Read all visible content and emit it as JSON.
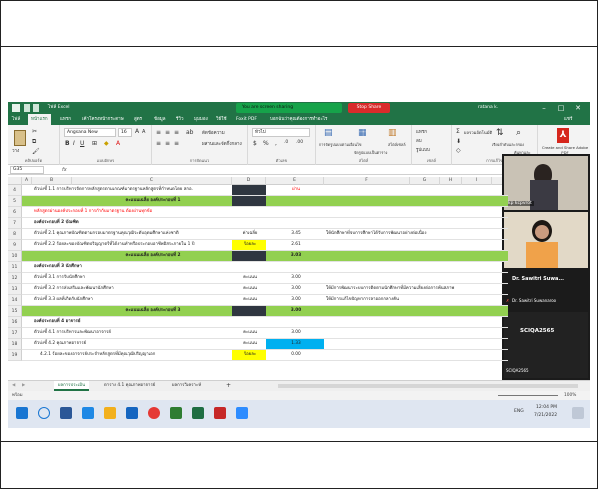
{
  "window": {
    "title_left": "ไฟล์ Excel",
    "share_status": "You are screen sharing",
    "stop_share": "Stop Share",
    "user": "ratana k.",
    "minimize": "–",
    "maximize": "□",
    "close": "✕"
  },
  "ribbon": {
    "tabs": [
      "ไฟล์",
      "หน้าแรก",
      "แทรก",
      "เค้าโครงหน้ากระดาษ",
      "สูตร",
      "ข้อมูล",
      "รีวิว",
      "มุมมอง",
      "วิธีใช้",
      "Foxit PDF",
      "บอกฉันว่าคุณต้องการทำอะไร"
    ],
    "active_tab_index": 1,
    "share_link": "แชร์",
    "font_name": "Angsana New",
    "font_size": "16",
    "number_format": "ทั่วไป",
    "groups": [
      "คลิปบอร์ด",
      "แบบอักษร",
      "การจัดแนว",
      "ตัวเลข",
      "สไตล์",
      "เซลล์",
      "การแก้ไข",
      "Adobe Acrobat"
    ],
    "buttons": {
      "paste": "วาง",
      "wrap": "ตัดข้อความ",
      "merge": "ผสานและจัดกึ่งกลาง",
      "conditional": "การจัดรูปแบบตามเงื่อนไข",
      "format_table": "จัดรูปแบบเป็นตาราง",
      "cell_styles": "สไตล์เซลล์",
      "insert": "แทรก",
      "delete": "ลบ",
      "format": "รูปแบบ",
      "autosum": "ผลรวมอัตโนมัติ",
      "sort": "เรียงลำดับและกรอง",
      "find": "ค้นหาและเลือก",
      "pdf": "Create and Share Adobe PDF"
    }
  },
  "formula_bar": {
    "name_box": "G35",
    "fx": "fx",
    "value": ""
  },
  "grid": {
    "columns": [
      "A",
      "B",
      "C",
      "D",
      "E",
      "F",
      "G",
      "H",
      "I"
    ],
    "rows": [
      {
        "num": "4",
        "b": "ตัวบ่งชี้ 1.1 การบริหารจัดการหลักสูตรตามเกณฑ์มาตรฐานหลักสูตรที่กำหนดโดย สกอ.",
        "c": "",
        "d": "",
        "e": "ผ่าน",
        "f": "",
        "style": "normal"
      },
      {
        "num": "5",
        "b": "",
        "c": "คะแนนเฉลี่ย องค์ประกอบที่ 1",
        "d": "",
        "e": "",
        "f": "",
        "style": "green"
      },
      {
        "num": "6",
        "b": "หลักสูตรผ่านองค์ประกอบที่ 1 การกำกับมาตรฐาน ต้องผ่านทุกข้อ",
        "c": "",
        "d": "",
        "e": "",
        "f": "",
        "style": "red"
      },
      {
        "num": "7",
        "b": "องค์ประกอบที่ 2 บัณฑิต",
        "c": "",
        "d": "",
        "e": "",
        "f": "",
        "style": "bold"
      },
      {
        "num": "8",
        "b": "ตัวบ่งชี้ 2.1 คุณภาพบัณฑิตตามกรอบมาตรฐานคุณวุฒิระดับอุดมศึกษาแห่งชาติ",
        "c": "",
        "d": "ค่าเฉลี่ย",
        "e": "3.45",
        "f": "ให้นักศึกษาที่จบการศึกษาได้รับการพัฒนาอย่างต่อเนื่อง",
        "style": "normal"
      },
      {
        "num": "9",
        "b": "ตัวบ่งชี้ 2.2 ร้อยละของบัณฑิตปริญญาตรีที่ได้งานทำหรือประกอบอาชีพอิสระภายใน 1 ปี",
        "c": "",
        "d": "ร้อยละ",
        "e": "2.61",
        "f": "",
        "style": "yellow-d"
      },
      {
        "num": "10",
        "b": "",
        "c": "คะแนนเฉลี่ย องค์ประกอบที่ 2",
        "d": "",
        "e": "3.03",
        "f": "",
        "style": "green"
      },
      {
        "num": "11",
        "b": "องค์ประกอบที่ 3 นักศึกษา",
        "c": "",
        "d": "",
        "e": "",
        "f": "",
        "style": "bold"
      },
      {
        "num": "12",
        "b": "ตัวบ่งชี้ 3.1 การรับนักศึกษา",
        "c": "",
        "d": "คะแนน",
        "e": "3.00",
        "f": "",
        "style": "normal"
      },
      {
        "num": "13",
        "b": "ตัวบ่งชี้ 3.2 การส่งเสริมและพัฒนานักศึกษา",
        "c": "",
        "d": "คะแนน",
        "e": "3.00",
        "f": "ให้มีการพัฒนาระบบการติดตามนักศึกษาที่มีความเสี่ยงต่อการพ้นสภาพ",
        "style": "normal"
      },
      {
        "num": "14",
        "b": "ตัวบ่งชี้ 3.3 ผลที่เกิดกับนักศึกษา",
        "c": "",
        "d": "คะแนน",
        "e": "3.00",
        "f": "ให้มีการแก้ไขปัญหาการลาออกกลางคัน",
        "style": "normal"
      },
      {
        "num": "15",
        "b": "",
        "c": "คะแนนเฉลี่ย องค์ประกอบที่ 3",
        "d": "",
        "e": "3.00",
        "f": "",
        "style": "green"
      },
      {
        "num": "16",
        "b": "องค์ประกอบที่ 4 อาจารย์",
        "c": "",
        "d": "",
        "e": "",
        "f": "",
        "style": "bold"
      },
      {
        "num": "17",
        "b": "ตัวบ่งชี้ 4.1 การบริหารและพัฒนาอาจารย์",
        "c": "",
        "d": "คะแนน",
        "e": "3.00",
        "f": "",
        "style": "normal"
      },
      {
        "num": "18",
        "b": "ตัวบ่งชี้ 4.2 คุณภาพอาจารย์",
        "c": "",
        "d": "คะแนน",
        "e": "1.33",
        "f": "",
        "style": "blue-e"
      },
      {
        "num": "19",
        "b": "4.2.1 ร้อยละของอาจารย์ประจำหลักสูตรที่มีคุณวุฒิปริญญาเอก",
        "c": "",
        "d": "ร้อยละ",
        "e": "0.00",
        "f": "",
        "style": "yellow-d2"
      }
    ]
  },
  "sheet_tabs": {
    "tabs": [
      "ผลการประเมิน",
      "ตาราง 4.1 คุณภาพอาจารย์",
      "ผลการวิเคราะห์"
    ],
    "active_index": 0,
    "add": "+"
  },
  "status": {
    "ready": "พร้อม",
    "zoom": "100%"
  },
  "taskbar": {
    "time": "12:04 PM",
    "date": "7/21/2022",
    "lang": "ENG"
  },
  "video": {
    "tile1_name": "Dr. Sawitri Suwa...",
    "tile1_corner": "kp kcpvrot",
    "tile2_name": "Dr. Sawitri Suwa...",
    "tile2_sub": "Dr. Sawitri Suwanaroo",
    "tile3_name": "SCIQA2565",
    "tile3_sub": "SCIQA2565"
  },
  "colors": {
    "excel_green": "#217346",
    "green_fill": "#92d050",
    "yellow_fill": "#ffff00",
    "blue_fill": "#00b0f0",
    "red_text": "#ff0000",
    "stop_red": "#d92b2b"
  }
}
